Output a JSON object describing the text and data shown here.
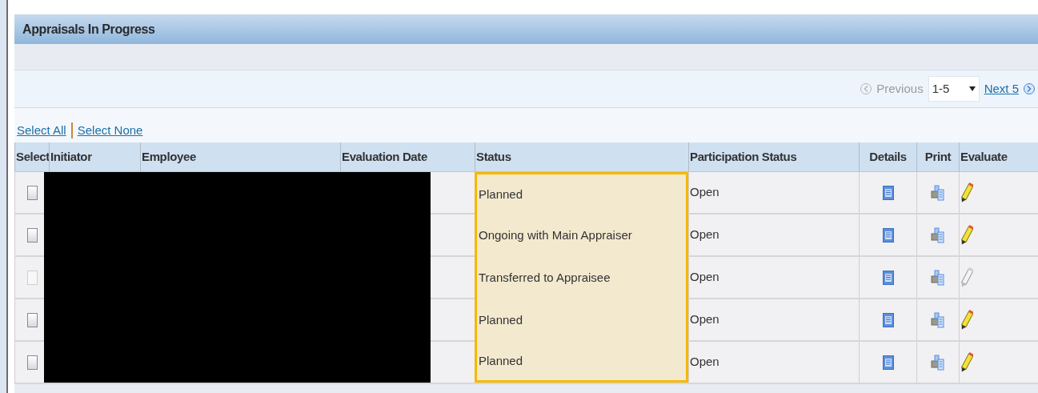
{
  "panel": {
    "title": "Appraisals In Progress"
  },
  "pager": {
    "previous": "Previous",
    "previous_disabled": true,
    "range": "1-5",
    "next": "Next 5"
  },
  "selection_links": [
    "Select All",
    "Select None"
  ],
  "table": {
    "columns": [
      "Select",
      "Initiator",
      "Employee",
      "Evaluation Date",
      "Status",
      "Participation Status",
      "Details",
      "Print",
      "Evaluate"
    ],
    "rows": [
      {
        "selected": false,
        "disabled": false,
        "status": "Planned",
        "status_highlighted": true,
        "participation_status": "Open"
      },
      {
        "selected": false,
        "disabled": false,
        "status": "Ongoing with Main Appraiser",
        "status_highlighted": true,
        "participation_status": "Open"
      },
      {
        "selected": false,
        "disabled": true,
        "status": "Transferred to Appraisee",
        "status_highlighted": true,
        "participation_status": "Open"
      },
      {
        "selected": false,
        "disabled": false,
        "status": "Planned",
        "status_highlighted": true,
        "participation_status": "Open"
      },
      {
        "selected": false,
        "disabled": false,
        "status": "Planned",
        "status_highlighted": true,
        "participation_status": "Open"
      }
    ]
  }
}
